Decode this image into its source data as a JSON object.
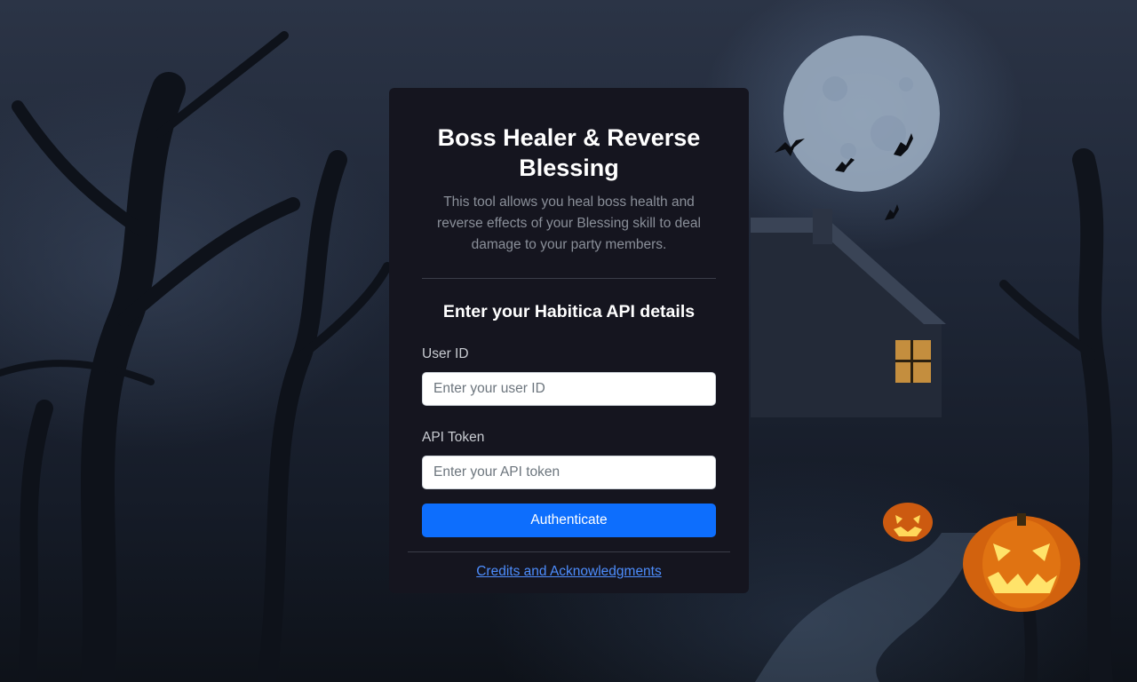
{
  "card": {
    "title": "Boss Healer & Reverse Blessing",
    "subtitle": "This tool allows you heal boss health and reverse effects of your Blessing skill to deal damage to your party members.",
    "section_title": "Enter your Habitica API details"
  },
  "form": {
    "user_id_label": "User ID",
    "user_id_placeholder": "Enter your user ID",
    "user_id_value": "",
    "api_token_label": "API Token",
    "api_token_placeholder": "Enter your API token",
    "api_token_value": "",
    "submit_label": "Authenticate"
  },
  "footer": {
    "credits_link": "Credits and Acknowledgments"
  },
  "colors": {
    "card_background": "#15151f",
    "primary_button": "#0d6efd",
    "link": "#4d8dfd",
    "muted_text": "#8a8f99"
  },
  "background": {
    "theme": "haunted-forest-halloween",
    "icons": [
      "moon-icon",
      "bat-icon",
      "haunted-house-icon",
      "jack-o-lantern-icon"
    ]
  }
}
